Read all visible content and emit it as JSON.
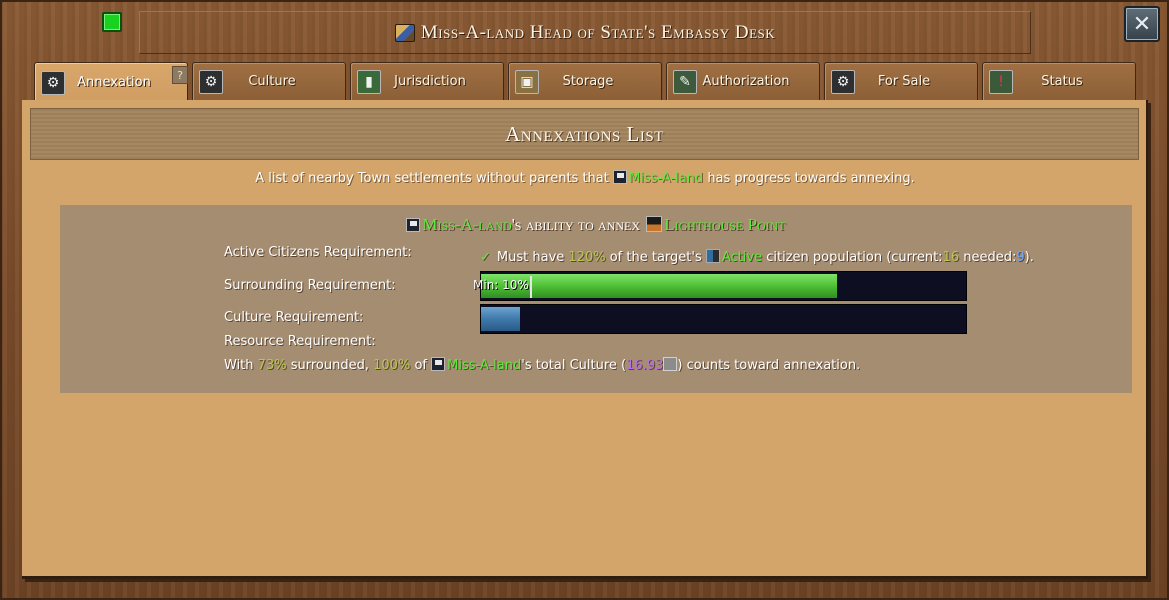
{
  "window": {
    "title": "Miss-A-land Head of State's Embassy Desk",
    "title_icon": "embassy-desk-icon",
    "status_light_color": "#19d11f",
    "close_label": "✕"
  },
  "tabs": [
    {
      "label": "Annexation",
      "icon": "gear-icon",
      "active": true
    },
    {
      "label": "Culture",
      "icon": "gear-icon",
      "active": false
    },
    {
      "label": "Jurisdiction",
      "icon": "map-icon",
      "active": false
    },
    {
      "label": "Storage",
      "icon": "crate-icon",
      "active": false
    },
    {
      "label": "Authorization",
      "icon": "document-icon",
      "active": false
    },
    {
      "label": "For Sale",
      "icon": "gear-icon",
      "active": false
    },
    {
      "label": "Status",
      "icon": "status-icon",
      "active": false
    }
  ],
  "help_label": "?",
  "section": {
    "title": "Annexations List",
    "intro_prefix": "A list of nearby Town settlements without parents that",
    "intro_entity": "Miss-A-land",
    "intro_suffix": "has progress towards annexing."
  },
  "annex": {
    "heading_entity": "Miss-A-land",
    "heading_middle": "'s ability to annex",
    "heading_target": "Lighthouse Point",
    "requirements": {
      "active_citizens_label": "Active Citizens Requirement:",
      "surrounding_label": "Surrounding Requirement:",
      "culture_label": "Culture Requirement:",
      "resource_label": "Resource Requirement:"
    },
    "citizens": {
      "check": "✓",
      "text_1": "Must have",
      "percent": "120%",
      "text_2": "of the target's",
      "active_word": "Active",
      "text_3": "citizen population (current:",
      "current": "16",
      "text_4": "needed:",
      "needed": "9",
      "text_5": ")."
    },
    "surrounding_bar": {
      "min_label": "Min: 10%",
      "min_fraction": 0.1,
      "fraction": 0.73,
      "color": "#4fbf35"
    },
    "culture_bar": {
      "fraction": 0.08,
      "color": "#3f79ab"
    },
    "summary": {
      "with": "With",
      "surrounded_pct": "73%",
      "surrounded_word": "surrounded,",
      "culture_pct": "100%",
      "of": "of",
      "entity": "Miss-A-land",
      "possessive": "'s total Culture (",
      "culture_value": "16.93",
      "closing": ") counts toward annexation."
    }
  }
}
